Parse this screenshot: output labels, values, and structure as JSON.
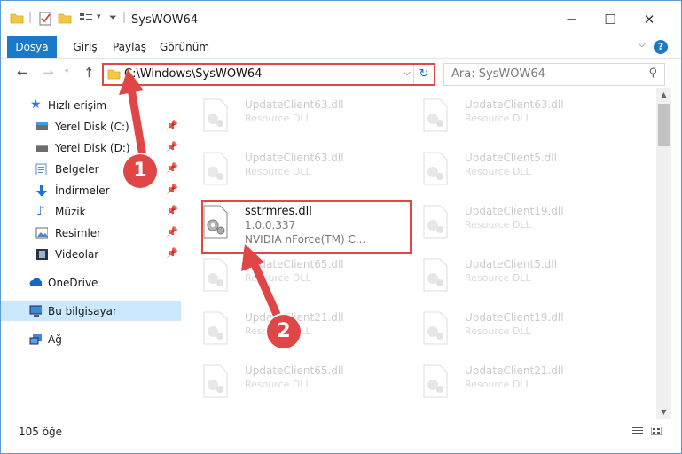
{
  "window": {
    "title": "SysWOW64",
    "controls": {
      "minimize": "─",
      "maximize": "☐",
      "close": "✕"
    }
  },
  "ribbon": {
    "tabs": [
      "Dosya",
      "Giriş",
      "Paylaş",
      "Görünüm"
    ],
    "active_tab": "Dosya",
    "help": "?"
  },
  "nav": {
    "address": "C:\\Windows\\SysWOW64",
    "search_placeholder": "Ara: SysWOW64"
  },
  "sidebar": {
    "items": [
      {
        "label": "Hızlı erişim",
        "icon": "star-icon"
      },
      {
        "label": "Yerel Disk (C:)",
        "icon": "drive-icon",
        "pinned": true
      },
      {
        "label": "Yerel Disk (D:)",
        "icon": "drive-icon",
        "pinned": true
      },
      {
        "label": "Belgeler",
        "icon": "document-icon",
        "pinned": true
      },
      {
        "label": "İndirmeler",
        "icon": "download-icon",
        "pinned": true
      },
      {
        "label": "Müzik",
        "icon": "music-icon",
        "pinned": true
      },
      {
        "label": "Resimler",
        "icon": "picture-icon",
        "pinned": true
      },
      {
        "label": "Videolar",
        "icon": "video-icon",
        "pinned": true
      },
      {
        "label": "OneDrive",
        "icon": "cloud-icon"
      },
      {
        "label": "Bu bilgisayar",
        "icon": "computer-icon",
        "selected": true
      },
      {
        "label": "Ağ",
        "icon": "network-icon"
      }
    ]
  },
  "files": {
    "left_column": [
      {
        "name": "UpdateClient63.dll",
        "type": "Resource DLL"
      },
      {
        "name": "UpdateClient63.dll",
        "type": "Resource DLL"
      },
      {
        "name": "sstrmres.dll",
        "version": "1.0.0.337",
        "description": "NVIDIA nForce(TM) C...",
        "selected": true
      },
      {
        "name": "UpdateClient65.dll",
        "type": "Resource DLL"
      },
      {
        "name": "UpdateClient21.dll",
        "type": "Resource DLL"
      },
      {
        "name": "UpdateClient65.dll",
        "type": "Resource DLL"
      }
    ],
    "right_column": [
      {
        "name": "UpdateClient63.dll",
        "type": "Resource DLL"
      },
      {
        "name": "UpdateClient5.dll",
        "type": "Resource DLL"
      },
      {
        "name": "UpdateClient19.dll",
        "type": "Resource DLL"
      },
      {
        "name": "UpdateClient5.dll",
        "type": "Resource DLL"
      },
      {
        "name": "UpdateClient19.dll",
        "type": "Resource DLL"
      },
      {
        "name": "UpdateClient21.dll",
        "type": "Resource DLL"
      }
    ]
  },
  "status": {
    "item_count": "105 öğe"
  },
  "callouts": {
    "step1": "1",
    "step2": "2",
    "color": "#e14646"
  },
  "colors": {
    "accent": "#1979ca",
    "selection": "#cce8ff",
    "highlight": "#e14646"
  }
}
